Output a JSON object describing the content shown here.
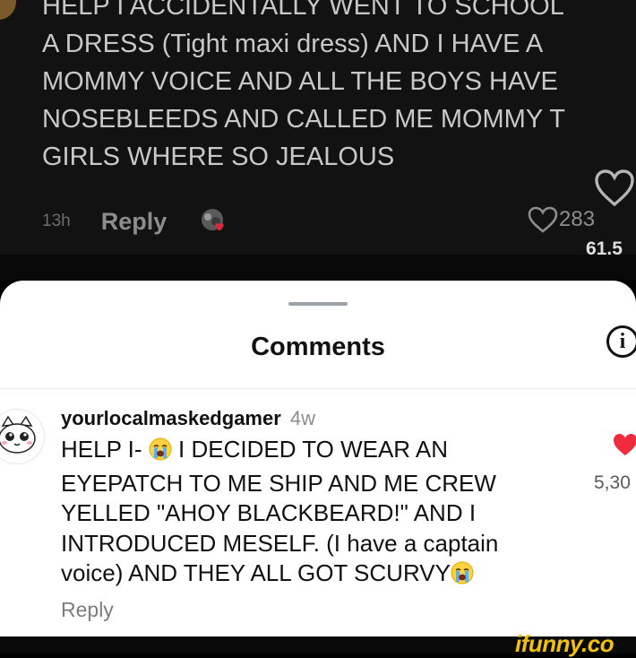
{
  "top_comment": {
    "text": "HELP I ACCIDENTALLY WENT TO SCHOOL\nA DRESS (Tight maxi dress) AND I HAVE A\nMOMMY VOICE AND ALL THE BOYS HAVE\nNOSEBLEEDS AND CALLED ME MOMMY T\nGIRLS WHERE SO JEALOUS",
    "time": "13h",
    "reply_label": "Reply",
    "like_count": "283",
    "views": "61.5"
  },
  "sheet": {
    "title": "Comments",
    "info_glyph": "i"
  },
  "comment": {
    "username": "yourlocalmaskedgamer",
    "time": "4w",
    "line1_a": "HELP I- ",
    "line1_b": " I DECIDED TO WEAR AN",
    "middle": "EYEPATCH TO ME SHIP AND ME CREW YELLED \"AHOY BLACKBEARD!\" AND I INTRODUCED MESELF. (I have a captain voice) AND THEY ALL GOT SCURVY",
    "reply_label": "Reply",
    "like_count": "5,30",
    "liked": true,
    "heart_color": "#ef2b3d"
  },
  "icons": {
    "emoji": "loudly-crying-face-icon",
    "heart": "heart-icon",
    "info": "info-icon"
  },
  "watermark": "ifunny.co",
  "colors": {
    "top_bg": "#121212",
    "sheet_bg": "#ffffff",
    "watermark": "#f2c10d"
  }
}
